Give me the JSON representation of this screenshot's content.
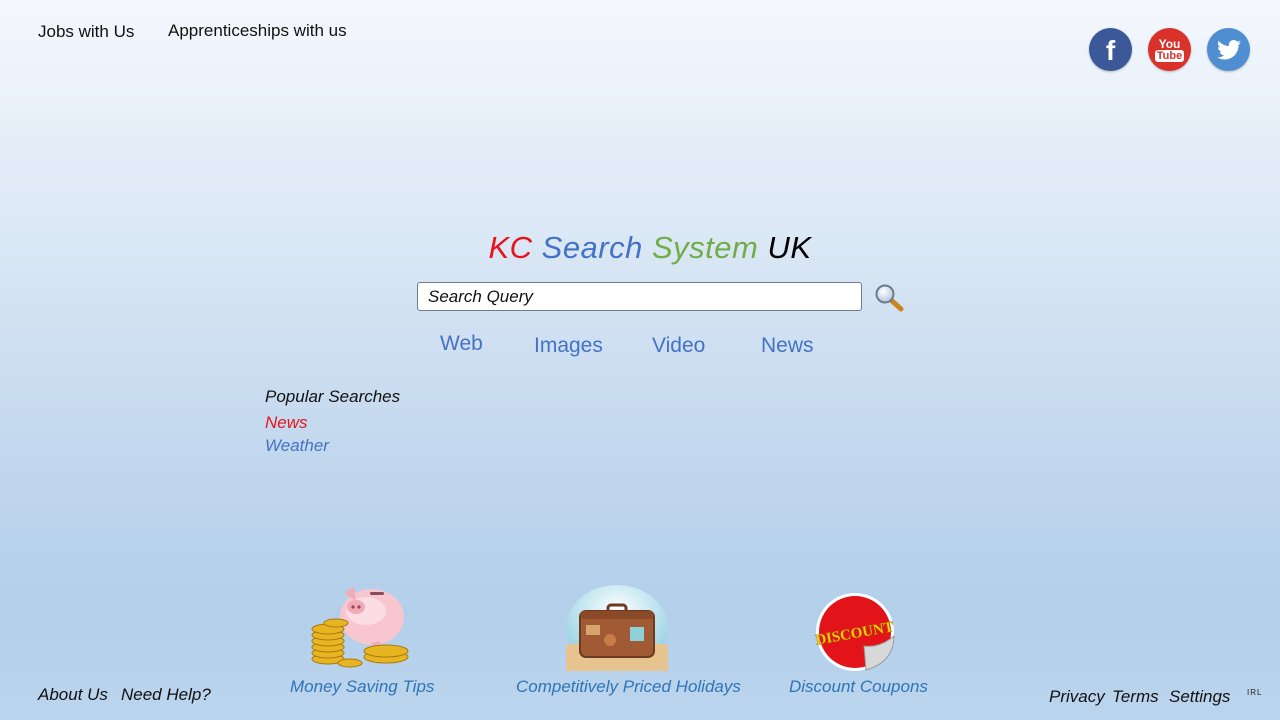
{
  "header": {
    "links": [
      "Jobs with Us",
      "Apprenticeships with us"
    ],
    "social": [
      {
        "name": "facebook",
        "glyph": "f",
        "color": "#3b5998"
      },
      {
        "name": "youtube",
        "glyph_top": "You",
        "glyph_bottom": "Tube",
        "color": "#d9322b"
      },
      {
        "name": "twitter",
        "color": "#4f8fd1"
      }
    ]
  },
  "logo": {
    "parts": [
      {
        "text": "KC",
        "color": "#e8141c"
      },
      {
        "text": "Search",
        "color": "#4472c4"
      },
      {
        "text": "System",
        "color": "#70ad47"
      },
      {
        "text": "UK",
        "color": "#000000"
      }
    ]
  },
  "search": {
    "placeholder": "Search Query",
    "value": ""
  },
  "tabs": [
    "Web",
    "Images",
    "Video",
    "News"
  ],
  "popular": {
    "title": "Popular Searches",
    "items": [
      {
        "label": "News",
        "color": "#e8141c"
      },
      {
        "label": "Weather",
        "color": "#4472c4"
      }
    ]
  },
  "promos": [
    {
      "label": "Money Saving Tips",
      "icon": "piggy-bank"
    },
    {
      "label": "Competitively Priced Holidays",
      "icon": "suitcase"
    },
    {
      "label": "Discount Coupons",
      "icon": "discount-sticker",
      "sticker_text": "DISCOUNT"
    }
  ],
  "footer": {
    "left": [
      "About Us",
      "Need Help?"
    ],
    "right": [
      "Privacy",
      "Terms",
      "Settings"
    ],
    "corner": "IRL"
  }
}
